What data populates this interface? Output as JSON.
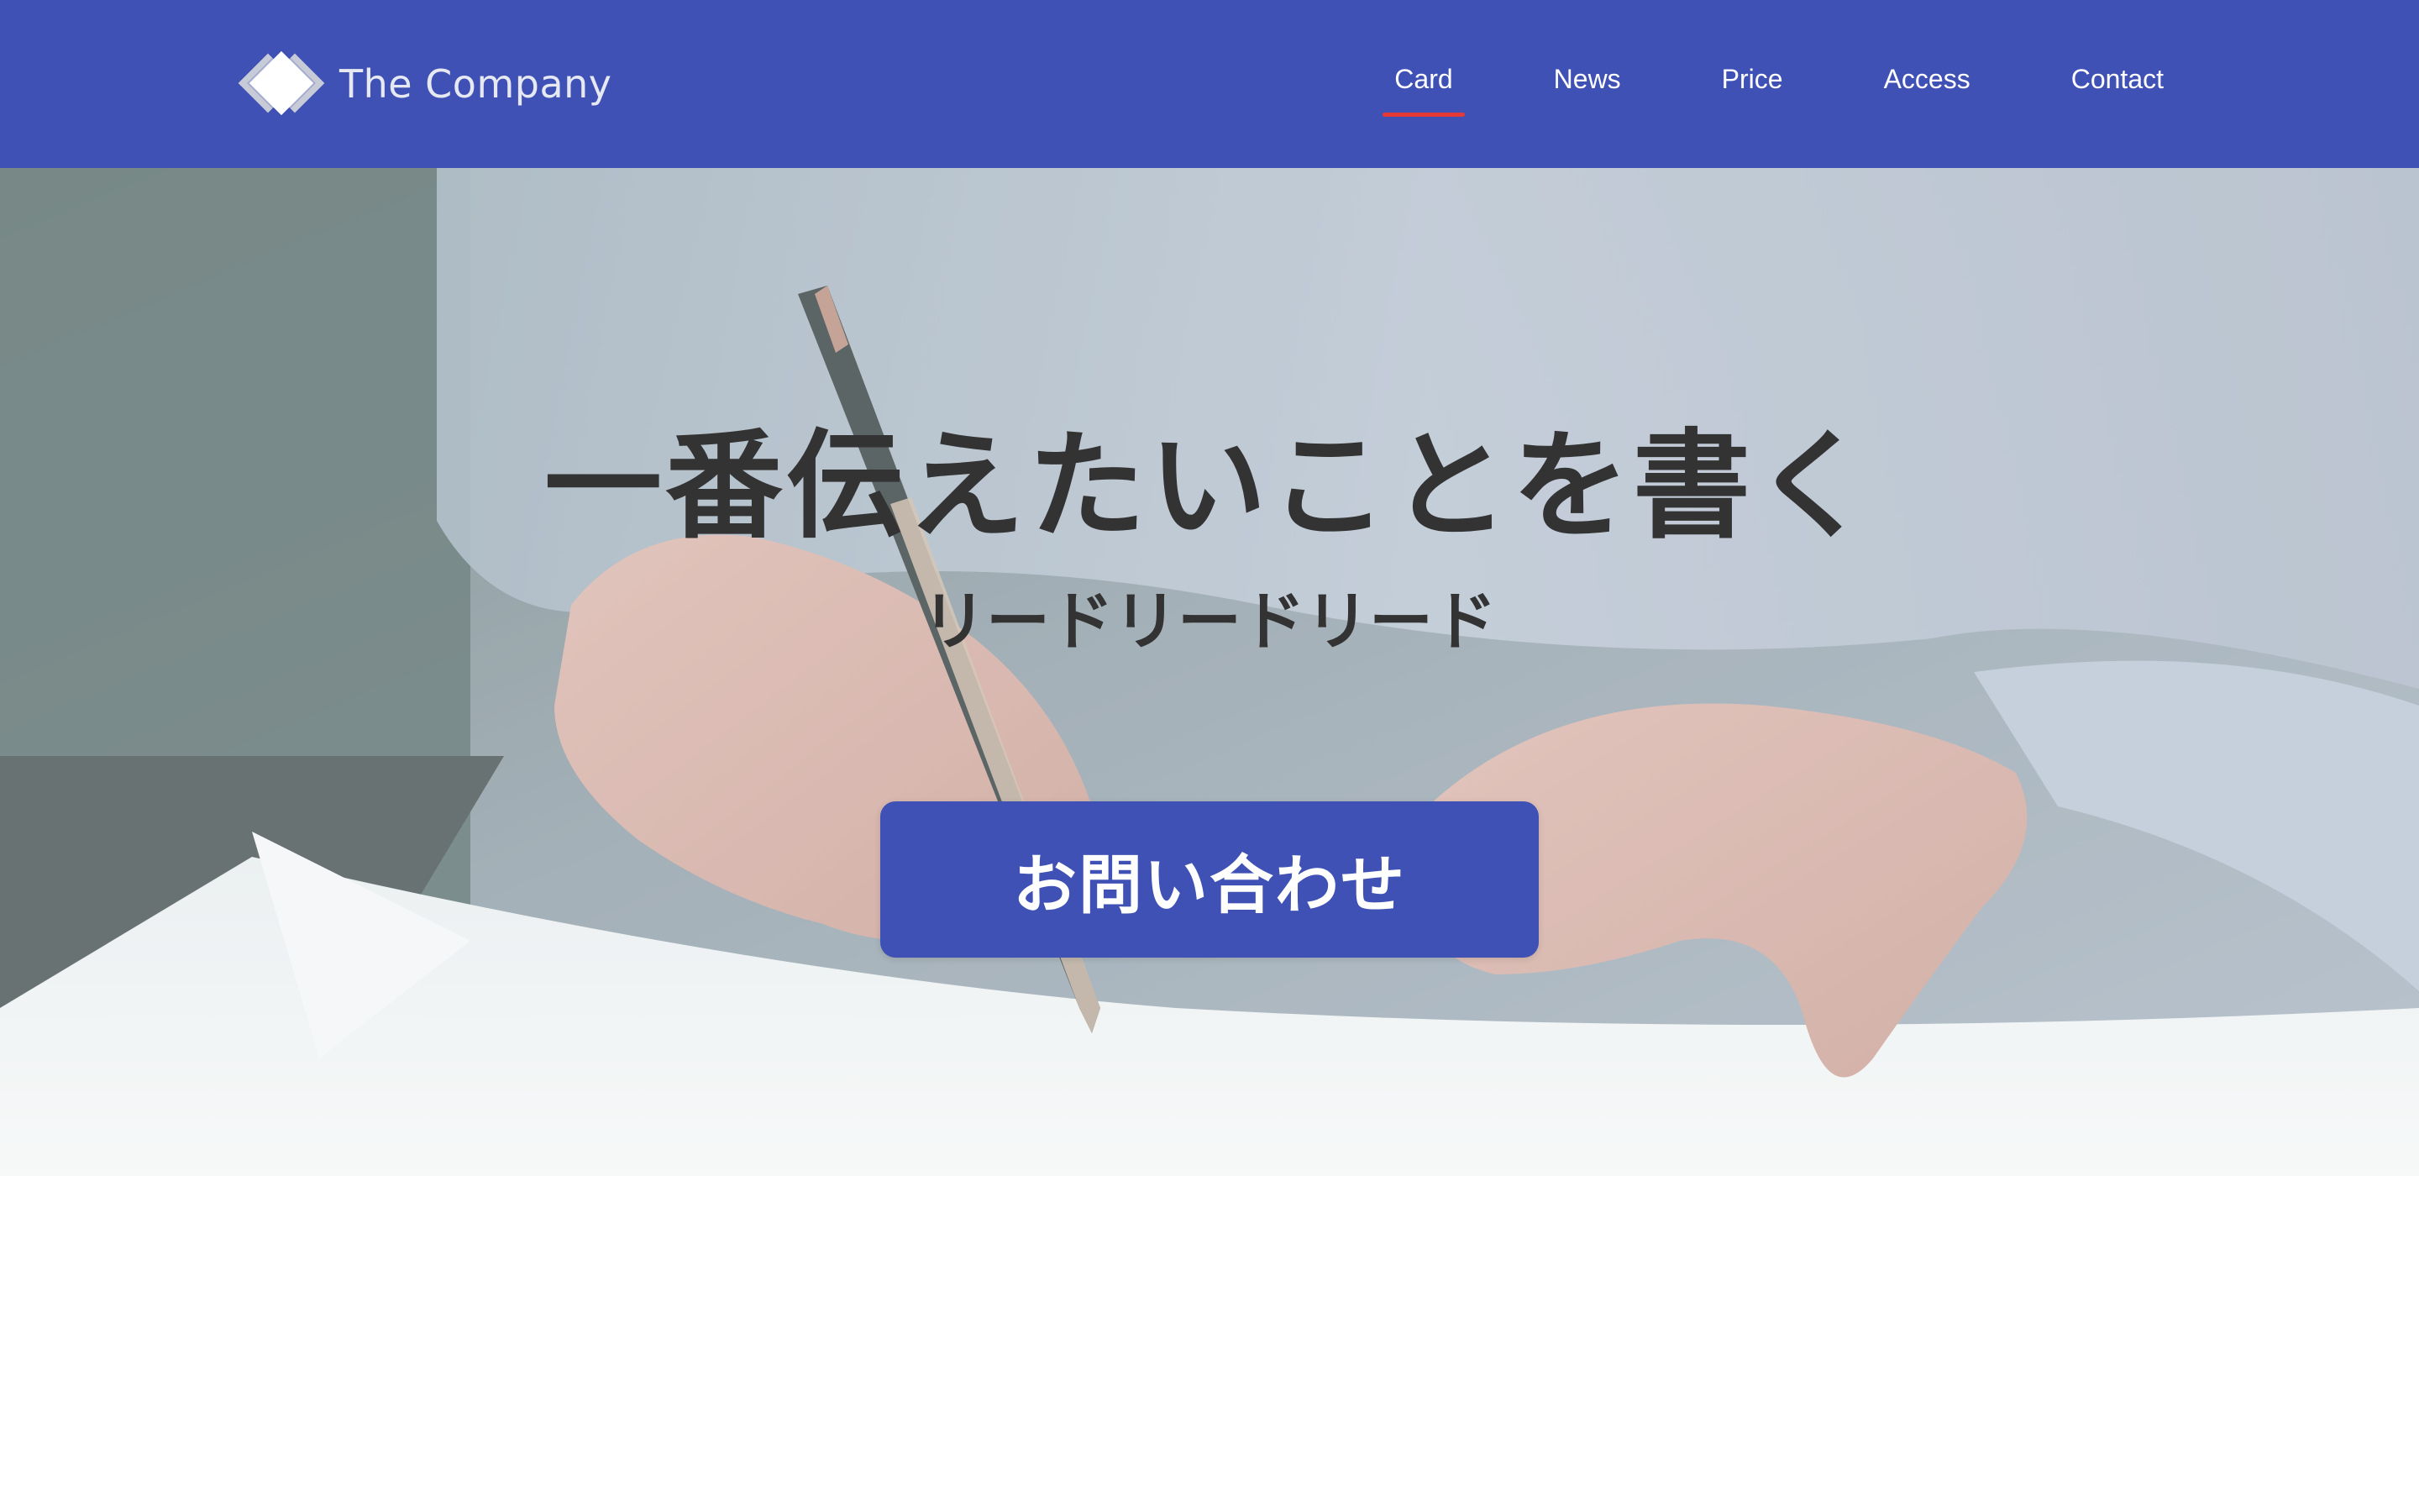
{
  "header": {
    "logo_text": "The Company",
    "nav": [
      {
        "label": "Card",
        "active": true
      },
      {
        "label": "News",
        "active": false
      },
      {
        "label": "Price",
        "active": false
      },
      {
        "label": "Access",
        "active": false
      },
      {
        "label": "Contact",
        "active": false
      }
    ]
  },
  "hero": {
    "title": "一番伝えたいことを書く",
    "lead": "リードリードリード",
    "cta_label": "お問い合わせ",
    "background_image": "photo of a hand writing with a pen on paper"
  },
  "colors": {
    "brand": "#3f51b5",
    "active_underline": "#e53935",
    "hero_text": "#333333"
  }
}
